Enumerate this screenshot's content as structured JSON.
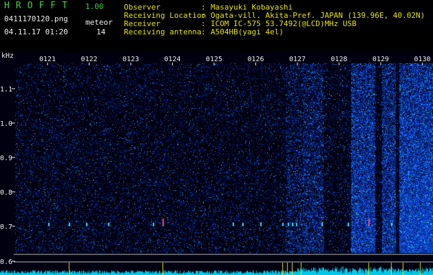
{
  "header": {
    "app_title": "HROFFT",
    "app_version": "1.00",
    "file_name": "0411170120.png",
    "datetime": "04.11.17 01:20",
    "meteor_label": "meteor",
    "meteor_count": "14"
  },
  "station": [
    {
      "label": "Observer",
      "sep": ":",
      "value": "Masayuki Kobayashi"
    },
    {
      "label": "Receiving Location",
      "sep": ":",
      "value": "Ogata-vill. Akita-Pref. JAPAN (139.96E, 40.02N)"
    },
    {
      "label": "Receiver",
      "sep": ":",
      "value": "ICOM IC-575 53.7492(@LCD)MHz USB"
    },
    {
      "label": "Receiving antenna",
      "sep": ":",
      "value": "A504HB(yagi 4el)"
    }
  ],
  "axis": {
    "unit": "kHz",
    "y_ticks": [
      "1.1",
      "1.0",
      "0.9",
      "0.8",
      "0.7",
      "0.6"
    ],
    "time_labels": [
      "0121",
      "0122",
      "0123",
      "0124",
      "0125",
      "0126",
      "0127",
      "0128",
      "0129",
      "0130"
    ]
  },
  "colors": {
    "background": "#000000",
    "title_green": "#3cd23c",
    "label_yellow": "#e6e600",
    "text_white": "#f0f0f0",
    "tick_cyan": "#00d8ff",
    "spectrum_blue": "#2a5cff"
  }
}
